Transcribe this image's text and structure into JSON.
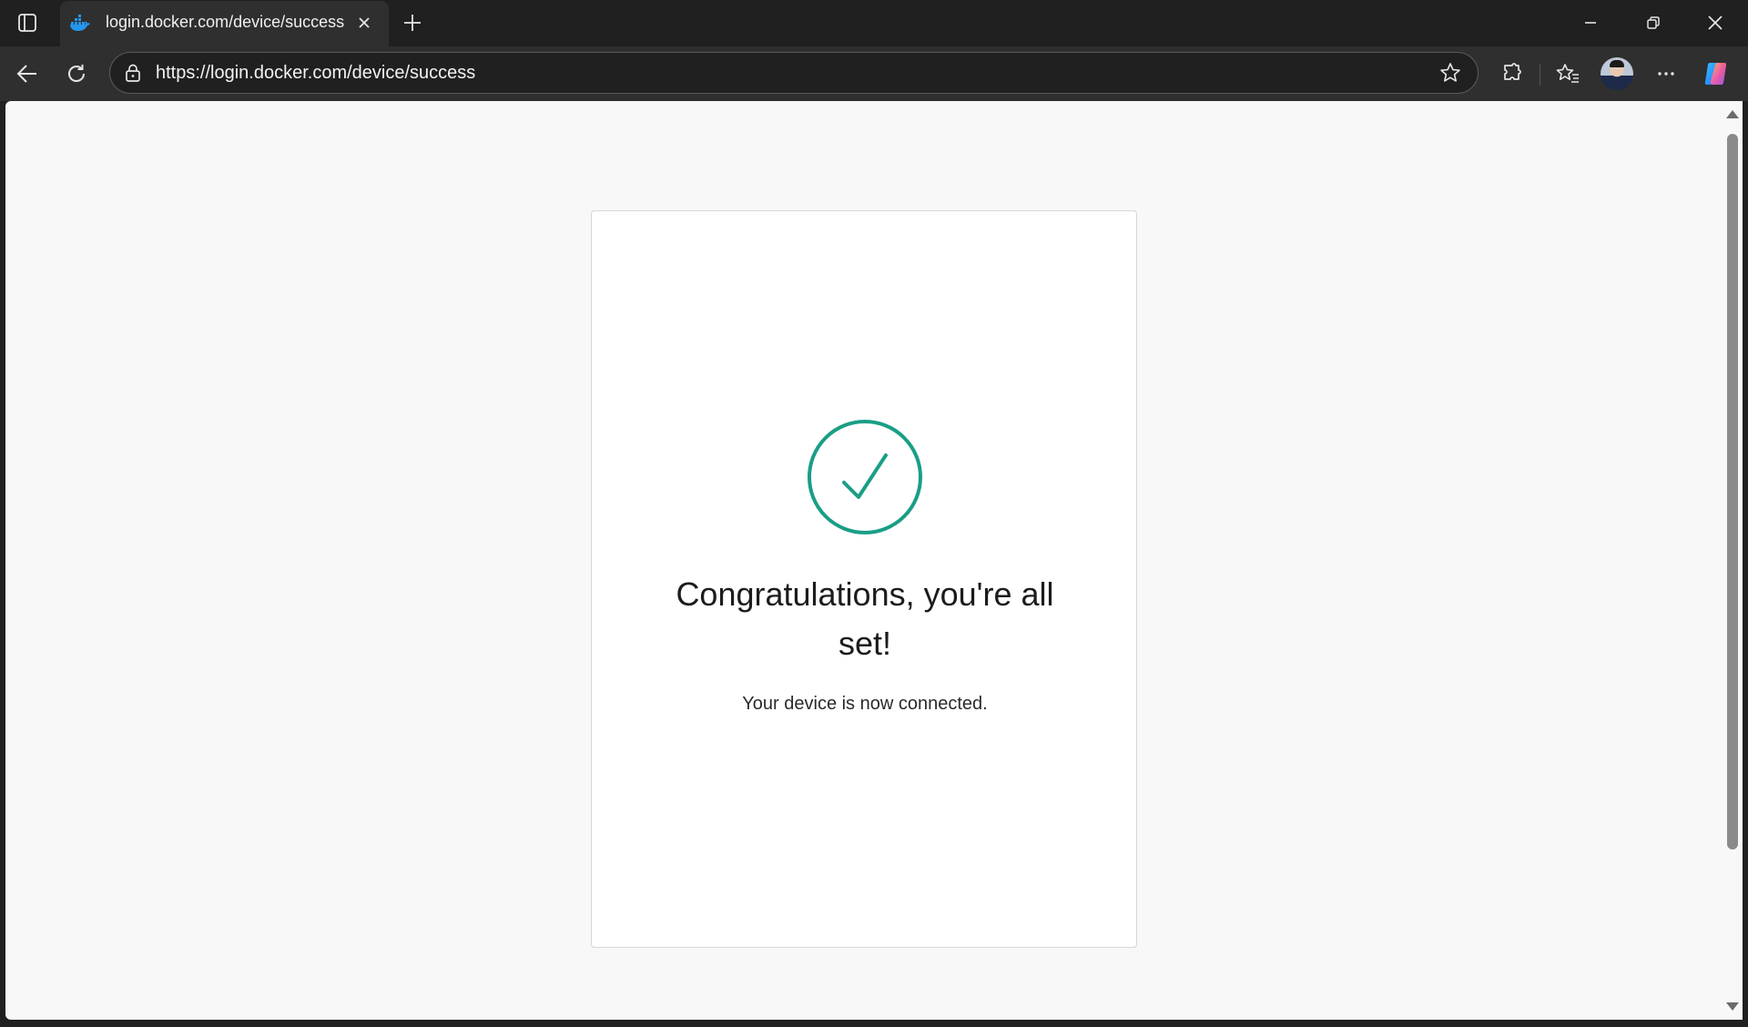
{
  "browser": {
    "tab": {
      "title": "login.docker.com/device/success",
      "favicon": "docker-whale-icon"
    },
    "address_bar": {
      "url": "https://login.docker.com/device/success"
    },
    "icons": {
      "tab_actions": "tab-actions-icon",
      "new_tab": "plus-icon",
      "back": "back-arrow-icon",
      "refresh": "refresh-icon",
      "lock": "lock-icon",
      "favorite_star": "star-icon",
      "extensions": "puzzle-icon",
      "favorites": "favorites-icon",
      "profile": "avatar",
      "more": "more-icon",
      "copilot": "copilot-icon"
    }
  },
  "page": {
    "headline": "Congratulations, you're all set!",
    "subtext": "Your device is now connected.",
    "accent_color": "#1a9e86"
  }
}
